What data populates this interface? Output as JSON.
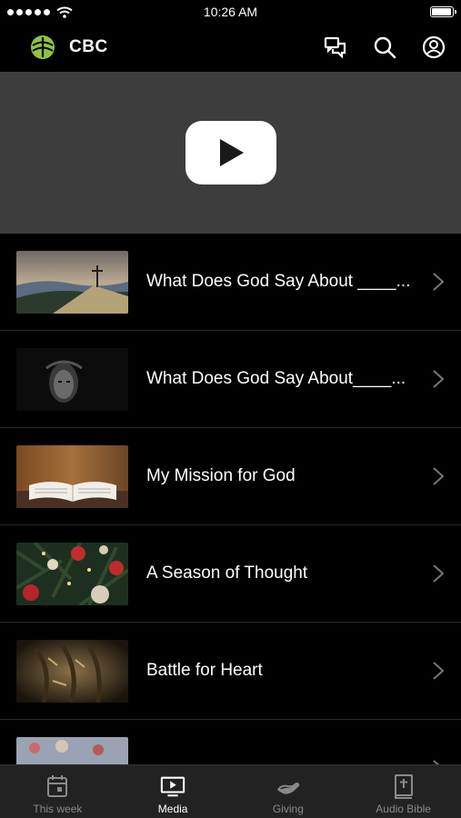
{
  "status_bar": {
    "time": "10:26 AM",
    "signal_dots": 5,
    "battery_level": 1.0
  },
  "header": {
    "title": "CBC",
    "logo_icon": "cbc-logo-icon",
    "icons": [
      "chat-icon",
      "search-icon",
      "profile-icon"
    ],
    "accent_color": "#8cc63f"
  },
  "video": {
    "icon": "youtube-play-icon"
  },
  "media_items": [
    {
      "title": "What Does God Say About ____..."
    },
    {
      "title": "What Does God Say About____..."
    },
    {
      "title": "My Mission for God"
    },
    {
      "title": "A Season of Thought"
    },
    {
      "title": "Battle for Heart"
    },
    {
      "title": ""
    }
  ],
  "tabs": [
    {
      "label": "This week",
      "icon": "calendar-icon",
      "active": false
    },
    {
      "label": "Media",
      "icon": "media-play-icon",
      "active": true
    },
    {
      "label": "Giving",
      "icon": "giving-hand-icon",
      "active": false
    },
    {
      "label": "Audio Bible",
      "icon": "bible-icon",
      "active": false
    }
  ]
}
